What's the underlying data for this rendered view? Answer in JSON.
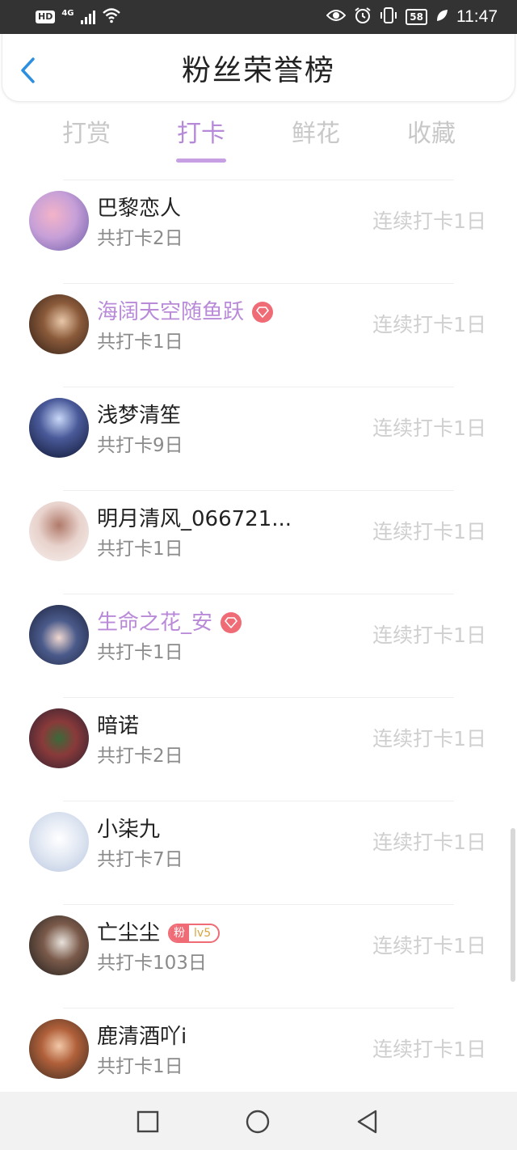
{
  "status_bar": {
    "hd": "HD",
    "network": "4G",
    "battery": "58",
    "time": "11:47",
    "icons": [
      "eye-icon",
      "alarm-icon",
      "vibrate-icon",
      "leaf-icon"
    ]
  },
  "header": {
    "title": "粉丝荣誉榜",
    "back_icon": "chevron-left-icon",
    "accent_color": "#2d8fe0"
  },
  "tabs": [
    {
      "label": "打赏",
      "active": false
    },
    {
      "label": "打卡",
      "active": true
    },
    {
      "label": "鲜花",
      "active": false
    },
    {
      "label": "收藏",
      "active": false
    }
  ],
  "colors": {
    "active_tab": "#b78ad9",
    "vip_name": "#b98ad8",
    "badge": "#ef6b75"
  },
  "list": [
    {
      "name": "巴黎恋人",
      "total": "共打卡2日",
      "streak": "连续打卡1日",
      "vip": false,
      "badge": "",
      "avatar_bg": "#8b6fb5"
    },
    {
      "name": "海阔天空随鱼跃",
      "total": "共打卡1日",
      "streak": "连续打卡1日",
      "vip": true,
      "badge": "gem",
      "avatar_bg": "#5a3a2a"
    },
    {
      "name": "浅梦清笙",
      "total": "共打卡9日",
      "streak": "连续打卡1日",
      "vip": false,
      "badge": "",
      "avatar_bg": "#1f2a4a"
    },
    {
      "name": "明月清风_066721...",
      "total": "共打卡1日",
      "streak": "连续打卡1日",
      "vip": false,
      "badge": "",
      "avatar_bg": "#e8d9d2"
    },
    {
      "name": "生命之花_安",
      "total": "共打卡1日",
      "streak": "连续打卡1日",
      "vip": true,
      "badge": "gem",
      "avatar_bg": "#2a3a5a"
    },
    {
      "name": "暗诺",
      "total": "共打卡2日",
      "streak": "连续打卡1日",
      "vip": false,
      "badge": "",
      "avatar_bg": "#4a3a4a"
    },
    {
      "name": "小柒九",
      "total": "共打卡7日",
      "streak": "连续打卡1日",
      "vip": false,
      "badge": "",
      "avatar_bg": "#d8dde8"
    },
    {
      "name": "亡尘尘",
      "total": "共打卡103日",
      "streak": "连续打卡1日",
      "vip": false,
      "badge": "fan",
      "fan_label": "粉",
      "fan_level": "lv5",
      "avatar_bg": "#3a3a3a"
    },
    {
      "name": "鹿清酒吖i",
      "total": "共打卡1日",
      "streak": "连续打卡1日",
      "vip": false,
      "badge": "",
      "avatar_bg": "#a5553a"
    }
  ],
  "nav_bar": {
    "icons": [
      "recent-apps-icon",
      "home-icon",
      "back-icon"
    ]
  }
}
